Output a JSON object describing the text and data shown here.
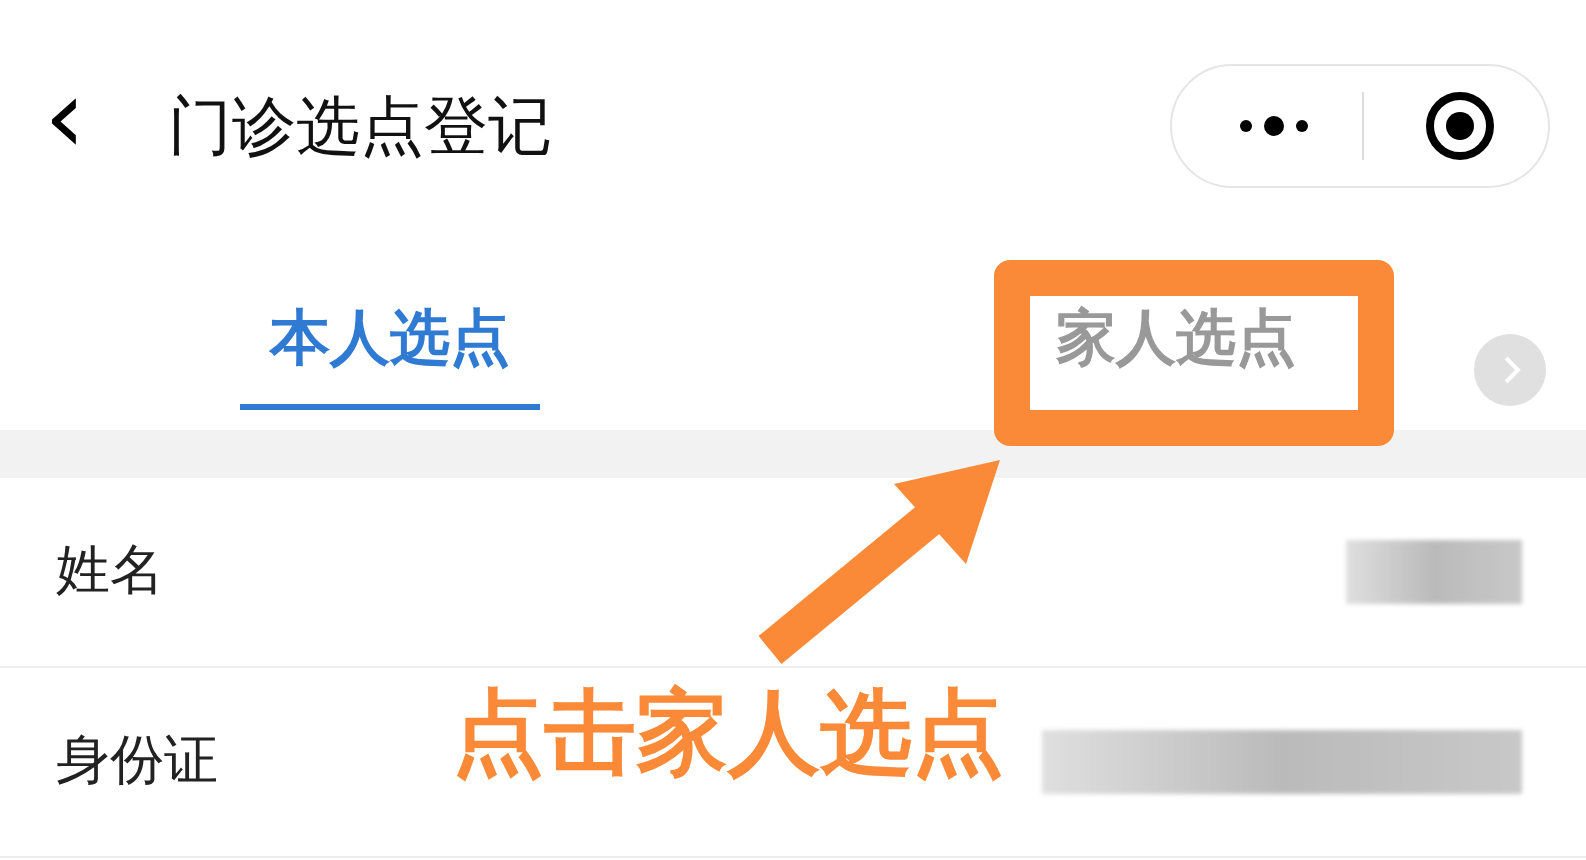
{
  "header": {
    "back": "‹",
    "title": "门诊选点登记"
  },
  "tabs": [
    {
      "label": "本人选点",
      "selected": true,
      "highlighted": false
    },
    {
      "label": "家人选点",
      "selected": false,
      "highlighted": true
    }
  ],
  "rows": [
    {
      "label": "姓名",
      "value_redacted": true
    },
    {
      "label": "身份证",
      "value_redacted": true
    }
  ],
  "annotation": {
    "text": "点击家人选点"
  }
}
